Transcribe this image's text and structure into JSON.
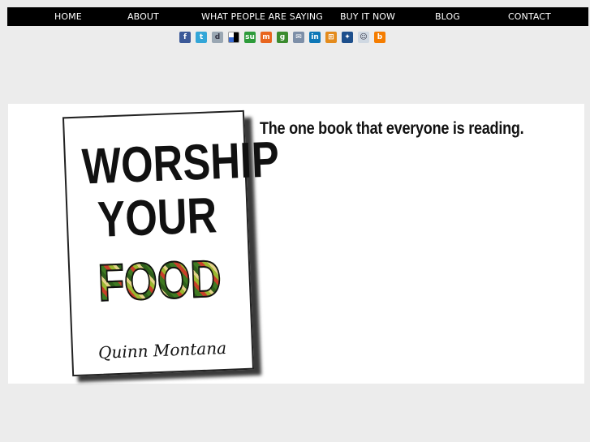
{
  "nav": {
    "items": [
      {
        "label": "HOME"
      },
      {
        "label": "ABOUT"
      },
      {
        "label": "WHAT PEOPLE ARE SAYING"
      },
      {
        "label": "BUY IT NOW"
      },
      {
        "label": "BLOG"
      },
      {
        "label": "CONTACT"
      }
    ]
  },
  "social": {
    "icons": [
      {
        "name": "facebook-icon",
        "glyph": "f",
        "color": "#3b5998"
      },
      {
        "name": "twitter-icon",
        "glyph": "t",
        "color": "#33a6d8"
      },
      {
        "name": "digg-icon",
        "glyph": "d",
        "color": "#9aa7b3"
      },
      {
        "name": "delicious-icon",
        "glyph": "",
        "color": "#ffffff"
      },
      {
        "name": "stumbleupon-icon",
        "glyph": "su",
        "color": "#2d9b3a"
      },
      {
        "name": "mixx-icon",
        "glyph": "m",
        "color": "#e8651e"
      },
      {
        "name": "google-bookmarks-icon",
        "glyph": "g",
        "color": "#3b8b2e"
      },
      {
        "name": "email-icon",
        "glyph": "✉",
        "color": "#7d8fa8"
      },
      {
        "name": "linkedin-icon",
        "glyph": "in",
        "color": "#0d77b7"
      },
      {
        "name": "windows-live-icon",
        "glyph": "⊞",
        "color": "#e48b1c"
      },
      {
        "name": "myspace-icon",
        "glyph": "✦",
        "color": "#1d4f8c"
      },
      {
        "name": "reddit-icon",
        "glyph": "☺",
        "color": "#cfd8e2"
      },
      {
        "name": "blogger-icon",
        "glyph": "b",
        "color": "#f57d00"
      }
    ]
  },
  "banner": {
    "tagline": "The one book that everyone is reading.",
    "book": {
      "title_line1": "WORSHIP",
      "title_line2": "YOUR",
      "title_line3": "FOOD",
      "author": "Quinn Montana"
    }
  }
}
